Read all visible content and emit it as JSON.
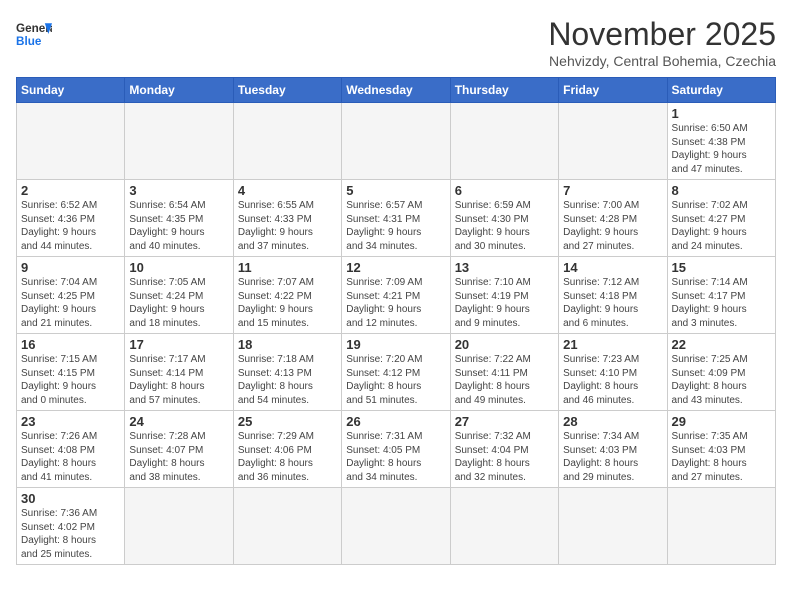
{
  "header": {
    "logo_general": "General",
    "logo_blue": "Blue",
    "title": "November 2025",
    "subtitle": "Nehvizdy, Central Bohemia, Czechia"
  },
  "columns": [
    "Sunday",
    "Monday",
    "Tuesday",
    "Wednesday",
    "Thursday",
    "Friday",
    "Saturday"
  ],
  "weeks": [
    [
      {
        "day": "",
        "info": ""
      },
      {
        "day": "",
        "info": ""
      },
      {
        "day": "",
        "info": ""
      },
      {
        "day": "",
        "info": ""
      },
      {
        "day": "",
        "info": ""
      },
      {
        "day": "",
        "info": ""
      },
      {
        "day": "1",
        "info": "Sunrise: 6:50 AM\nSunset: 4:38 PM\nDaylight: 9 hours\nand 47 minutes."
      }
    ],
    [
      {
        "day": "2",
        "info": "Sunrise: 6:52 AM\nSunset: 4:36 PM\nDaylight: 9 hours\nand 44 minutes."
      },
      {
        "day": "3",
        "info": "Sunrise: 6:54 AM\nSunset: 4:35 PM\nDaylight: 9 hours\nand 40 minutes."
      },
      {
        "day": "4",
        "info": "Sunrise: 6:55 AM\nSunset: 4:33 PM\nDaylight: 9 hours\nand 37 minutes."
      },
      {
        "day": "5",
        "info": "Sunrise: 6:57 AM\nSunset: 4:31 PM\nDaylight: 9 hours\nand 34 minutes."
      },
      {
        "day": "6",
        "info": "Sunrise: 6:59 AM\nSunset: 4:30 PM\nDaylight: 9 hours\nand 30 minutes."
      },
      {
        "day": "7",
        "info": "Sunrise: 7:00 AM\nSunset: 4:28 PM\nDaylight: 9 hours\nand 27 minutes."
      },
      {
        "day": "8",
        "info": "Sunrise: 7:02 AM\nSunset: 4:27 PM\nDaylight: 9 hours\nand 24 minutes."
      }
    ],
    [
      {
        "day": "9",
        "info": "Sunrise: 7:04 AM\nSunset: 4:25 PM\nDaylight: 9 hours\nand 21 minutes."
      },
      {
        "day": "10",
        "info": "Sunrise: 7:05 AM\nSunset: 4:24 PM\nDaylight: 9 hours\nand 18 minutes."
      },
      {
        "day": "11",
        "info": "Sunrise: 7:07 AM\nSunset: 4:22 PM\nDaylight: 9 hours\nand 15 minutes."
      },
      {
        "day": "12",
        "info": "Sunrise: 7:09 AM\nSunset: 4:21 PM\nDaylight: 9 hours\nand 12 minutes."
      },
      {
        "day": "13",
        "info": "Sunrise: 7:10 AM\nSunset: 4:19 PM\nDaylight: 9 hours\nand 9 minutes."
      },
      {
        "day": "14",
        "info": "Sunrise: 7:12 AM\nSunset: 4:18 PM\nDaylight: 9 hours\nand 6 minutes."
      },
      {
        "day": "15",
        "info": "Sunrise: 7:14 AM\nSunset: 4:17 PM\nDaylight: 9 hours\nand 3 minutes."
      }
    ],
    [
      {
        "day": "16",
        "info": "Sunrise: 7:15 AM\nSunset: 4:15 PM\nDaylight: 9 hours\nand 0 minutes."
      },
      {
        "day": "17",
        "info": "Sunrise: 7:17 AM\nSunset: 4:14 PM\nDaylight: 8 hours\nand 57 minutes."
      },
      {
        "day": "18",
        "info": "Sunrise: 7:18 AM\nSunset: 4:13 PM\nDaylight: 8 hours\nand 54 minutes."
      },
      {
        "day": "19",
        "info": "Sunrise: 7:20 AM\nSunset: 4:12 PM\nDaylight: 8 hours\nand 51 minutes."
      },
      {
        "day": "20",
        "info": "Sunrise: 7:22 AM\nSunset: 4:11 PM\nDaylight: 8 hours\nand 49 minutes."
      },
      {
        "day": "21",
        "info": "Sunrise: 7:23 AM\nSunset: 4:10 PM\nDaylight: 8 hours\nand 46 minutes."
      },
      {
        "day": "22",
        "info": "Sunrise: 7:25 AM\nSunset: 4:09 PM\nDaylight: 8 hours\nand 43 minutes."
      }
    ],
    [
      {
        "day": "23",
        "info": "Sunrise: 7:26 AM\nSunset: 4:08 PM\nDaylight: 8 hours\nand 41 minutes."
      },
      {
        "day": "24",
        "info": "Sunrise: 7:28 AM\nSunset: 4:07 PM\nDaylight: 8 hours\nand 38 minutes."
      },
      {
        "day": "25",
        "info": "Sunrise: 7:29 AM\nSunset: 4:06 PM\nDaylight: 8 hours\nand 36 minutes."
      },
      {
        "day": "26",
        "info": "Sunrise: 7:31 AM\nSunset: 4:05 PM\nDaylight: 8 hours\nand 34 minutes."
      },
      {
        "day": "27",
        "info": "Sunrise: 7:32 AM\nSunset: 4:04 PM\nDaylight: 8 hours\nand 32 minutes."
      },
      {
        "day": "28",
        "info": "Sunrise: 7:34 AM\nSunset: 4:03 PM\nDaylight: 8 hours\nand 29 minutes."
      },
      {
        "day": "29",
        "info": "Sunrise: 7:35 AM\nSunset: 4:03 PM\nDaylight: 8 hours\nand 27 minutes."
      }
    ],
    [
      {
        "day": "30",
        "info": "Sunrise: 7:36 AM\nSunset: 4:02 PM\nDaylight: 8 hours\nand 25 minutes."
      },
      {
        "day": "",
        "info": ""
      },
      {
        "day": "",
        "info": ""
      },
      {
        "day": "",
        "info": ""
      },
      {
        "day": "",
        "info": ""
      },
      {
        "day": "",
        "info": ""
      },
      {
        "day": "",
        "info": ""
      }
    ]
  ]
}
